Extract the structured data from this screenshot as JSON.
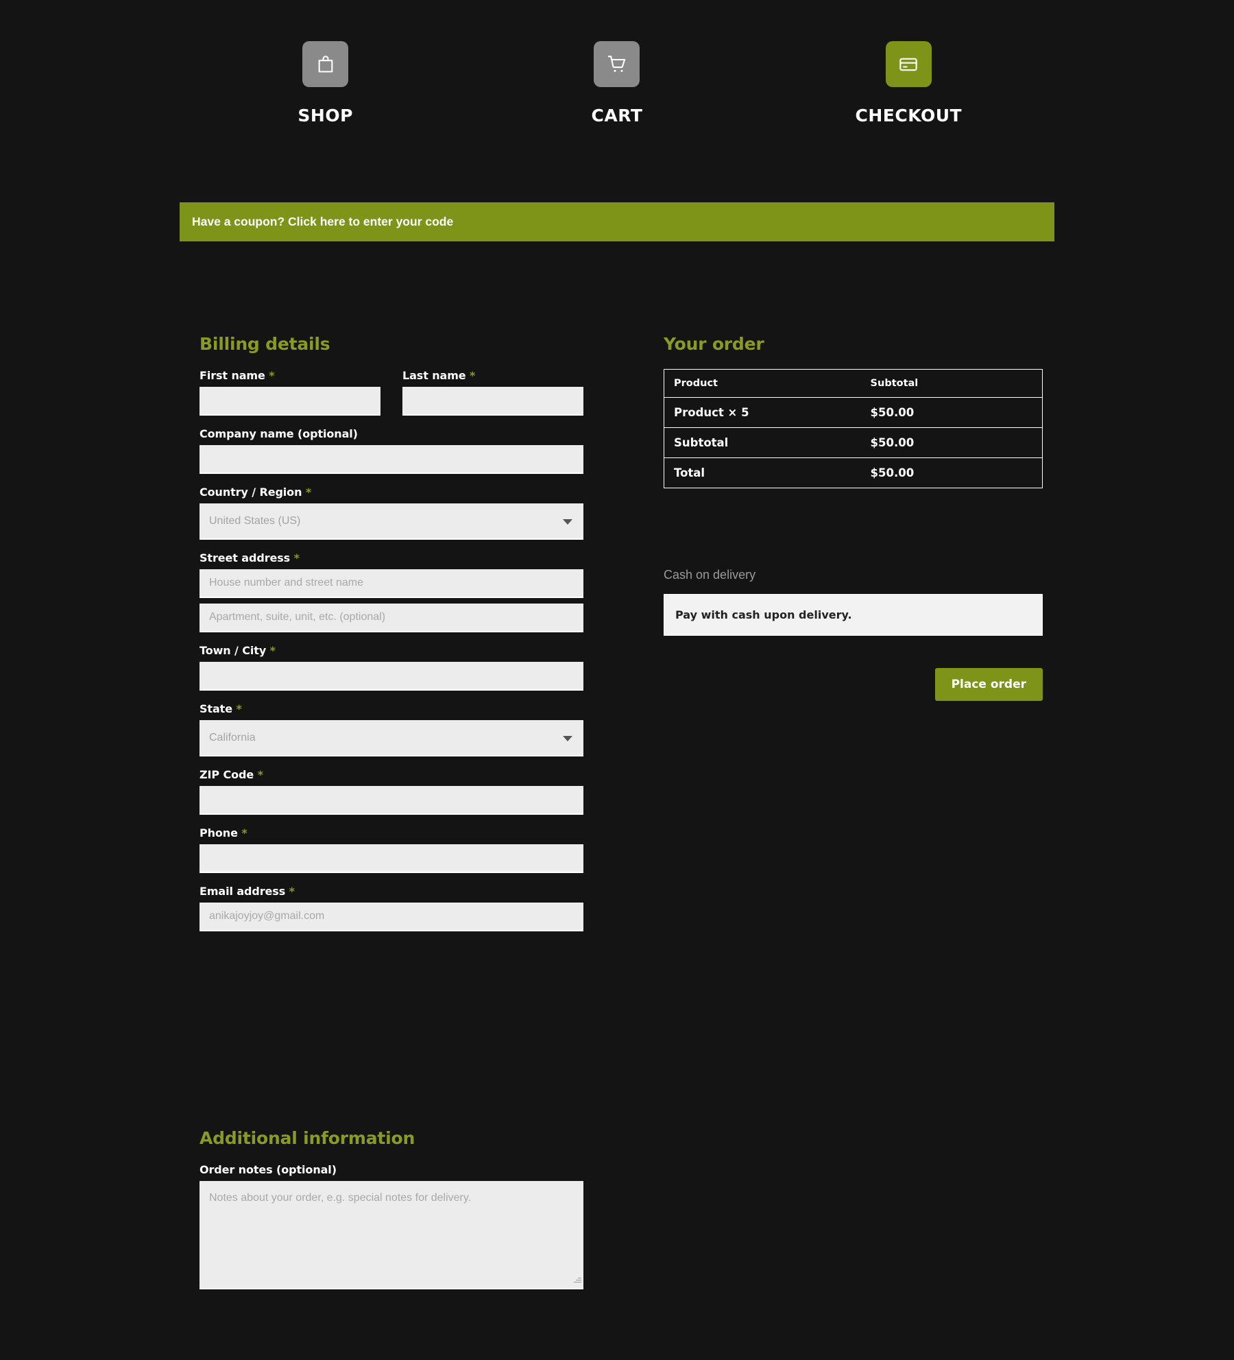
{
  "steps": [
    {
      "label": "SHOP",
      "icon": "shopping-bag-icon",
      "active": false
    },
    {
      "label": "CART",
      "icon": "shopping-cart-icon",
      "active": false
    },
    {
      "label": "CHECKOUT",
      "icon": "credit-card-icon",
      "active": true
    }
  ],
  "coupon": {
    "prefix": "Have a coupon?",
    "link": "Click here to enter your code",
    "full": "Have a coupon? Click here to enter your code"
  },
  "billing": {
    "title": "Billing details",
    "required_mark": "*",
    "fields": {
      "first_name": {
        "label": "First name",
        "required": true,
        "value": "",
        "placeholder": ""
      },
      "last_name": {
        "label": "Last name",
        "required": true,
        "value": "",
        "placeholder": ""
      },
      "company": {
        "label": "Company name (optional)",
        "required": false,
        "value": "",
        "placeholder": ""
      },
      "country": {
        "label": "Country / Region",
        "required": true,
        "value": "United States (US)"
      },
      "street": {
        "label": "Street address",
        "required": true,
        "placeholder": "House number and street name",
        "value": ""
      },
      "street2": {
        "label": "",
        "required": false,
        "placeholder": "Apartment, suite, unit, etc. (optional)",
        "value": ""
      },
      "city": {
        "label": "Town / City",
        "required": true,
        "value": "",
        "placeholder": ""
      },
      "state": {
        "label": "State",
        "required": true,
        "value": "California"
      },
      "zip": {
        "label": "ZIP Code",
        "required": true,
        "value": "",
        "placeholder": ""
      },
      "phone": {
        "label": "Phone",
        "required": true,
        "value": "",
        "placeholder": ""
      },
      "email": {
        "label": "Email address",
        "required": true,
        "value": "",
        "placeholder": "anikajoyjoy@gmail.com"
      }
    }
  },
  "additional": {
    "title": "Additional information",
    "order_notes": {
      "label": "Order notes (optional)",
      "placeholder": "Notes about your order, e.g. special notes for delivery.",
      "value": ""
    }
  },
  "order": {
    "title": "Your order",
    "headers": {
      "product": "Product",
      "subtotal": "Subtotal"
    },
    "rows": [
      {
        "name": "Product × 5",
        "amount": "$50.00"
      },
      {
        "name": "Subtotal",
        "amount": "$50.00"
      },
      {
        "name": "Total",
        "amount": "$50.00"
      }
    ]
  },
  "payment": {
    "method_title": "Cash on delivery",
    "description": "Pay with cash upon delivery.",
    "place_order_label": "Place order"
  },
  "colors": {
    "background": "#141414",
    "accent_green": "#7d9419",
    "heading_green": "#8a9a23",
    "input_bg": "#ececec",
    "step_inactive": "#8a8a8a",
    "text_white": "#ffffff",
    "placeholder_gray": "#a8a8a8"
  }
}
